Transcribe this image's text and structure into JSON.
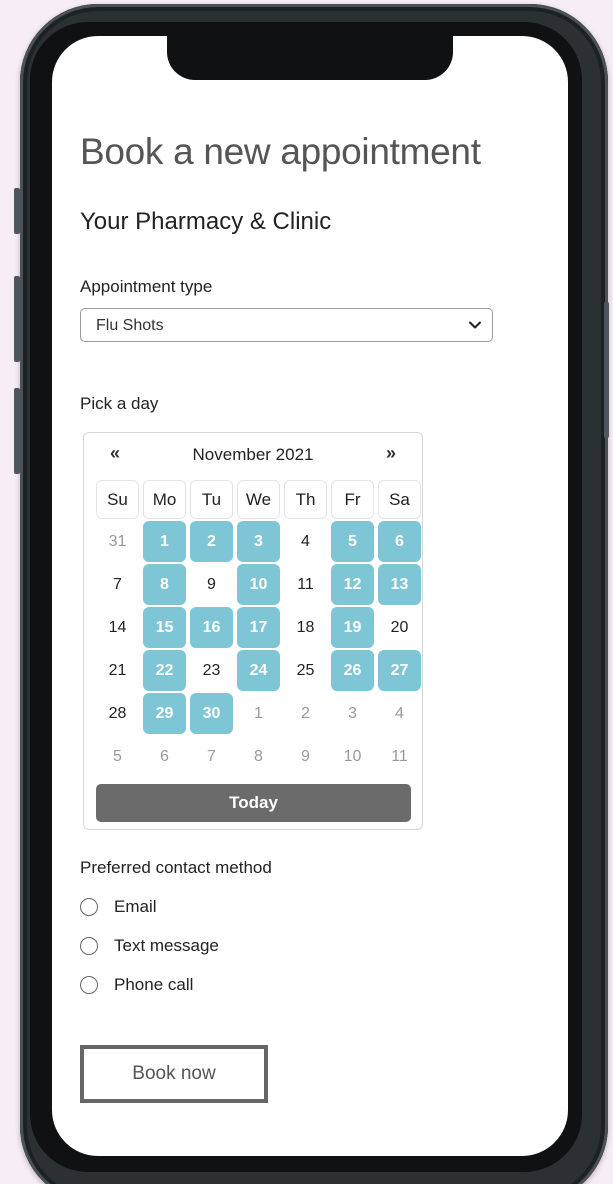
{
  "page": {
    "title": "Book a new appointment",
    "clinic_name": "Your Pharmacy & Clinic"
  },
  "appointment": {
    "label": "Appointment type",
    "selected": "Flu Shots",
    "icon": "chevron-down-icon"
  },
  "calendar": {
    "label": "Pick a day",
    "month": "November 2021",
    "prev": "«",
    "next": "»",
    "weekdays": [
      "Su",
      "Mo",
      "Tu",
      "We",
      "Th",
      "Fr",
      "Sa"
    ],
    "weeks": [
      [
        {
          "d": "31",
          "s": "muted"
        },
        {
          "d": "1",
          "s": "avail"
        },
        {
          "d": "2",
          "s": "avail"
        },
        {
          "d": "3",
          "s": "avail"
        },
        {
          "d": "4",
          "s": "normal"
        },
        {
          "d": "5",
          "s": "avail"
        },
        {
          "d": "6",
          "s": "avail"
        }
      ],
      [
        {
          "d": "7",
          "s": "normal"
        },
        {
          "d": "8",
          "s": "avail"
        },
        {
          "d": "9",
          "s": "normal"
        },
        {
          "d": "10",
          "s": "avail"
        },
        {
          "d": "11",
          "s": "normal"
        },
        {
          "d": "12",
          "s": "avail"
        },
        {
          "d": "13",
          "s": "avail"
        }
      ],
      [
        {
          "d": "14",
          "s": "normal"
        },
        {
          "d": "15",
          "s": "avail"
        },
        {
          "d": "16",
          "s": "avail"
        },
        {
          "d": "17",
          "s": "avail"
        },
        {
          "d": "18",
          "s": "normal"
        },
        {
          "d": "19",
          "s": "avail"
        },
        {
          "d": "20",
          "s": "normal"
        }
      ],
      [
        {
          "d": "21",
          "s": "normal"
        },
        {
          "d": "22",
          "s": "avail"
        },
        {
          "d": "23",
          "s": "normal"
        },
        {
          "d": "24",
          "s": "avail"
        },
        {
          "d": "25",
          "s": "normal"
        },
        {
          "d": "26",
          "s": "avail"
        },
        {
          "d": "27",
          "s": "avail"
        }
      ],
      [
        {
          "d": "28",
          "s": "normal"
        },
        {
          "d": "29",
          "s": "avail"
        },
        {
          "d": "30",
          "s": "avail"
        },
        {
          "d": "1",
          "s": "muted"
        },
        {
          "d": "2",
          "s": "muted"
        },
        {
          "d": "3",
          "s": "muted"
        },
        {
          "d": "4",
          "s": "muted"
        }
      ],
      [
        {
          "d": "5",
          "s": "muted"
        },
        {
          "d": "6",
          "s": "muted"
        },
        {
          "d": "7",
          "s": "muted"
        },
        {
          "d": "8",
          "s": "muted"
        },
        {
          "d": "9",
          "s": "muted"
        },
        {
          "d": "10",
          "s": "muted"
        },
        {
          "d": "11",
          "s": "muted"
        }
      ]
    ],
    "today_label": "Today"
  },
  "contact": {
    "label": "Preferred contact method",
    "options": [
      "Email",
      "Text message",
      "Phone call"
    ]
  },
  "actions": {
    "book_label": "Book now"
  },
  "colors": {
    "available_day": "#7ec6d5",
    "today_button": "#6b6b6b",
    "title_text": "#555555",
    "background": "#f7eef5"
  }
}
